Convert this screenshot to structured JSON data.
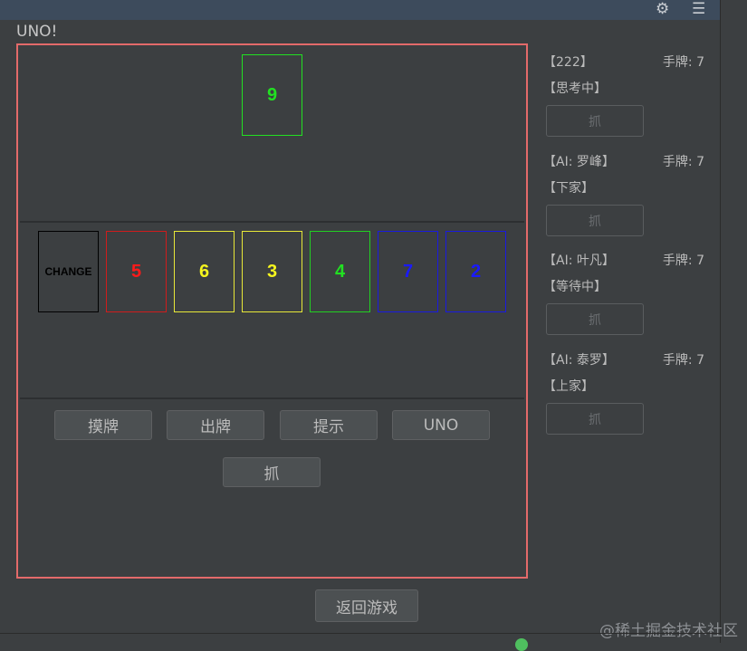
{
  "app": {
    "title": "UNO!"
  },
  "titlebar": {
    "settings_icon": "gear-icon",
    "minimize_icon": "minimize-icon"
  },
  "discard_pile": {
    "label": "9",
    "color": "#22e022"
  },
  "hand": [
    {
      "label": "CHANGE",
      "color": "#000000",
      "border": "#000000"
    },
    {
      "label": "5",
      "color": "#ff1a1a",
      "border": "#d01c1c"
    },
    {
      "label": "6",
      "color": "#f5f51e",
      "border": "#e8e838"
    },
    {
      "label": "3",
      "color": "#f5f51e",
      "border": "#e8e838"
    },
    {
      "label": "4",
      "color": "#22e022",
      "border": "#22d022"
    },
    {
      "label": "7",
      "color": "#1a1aff",
      "border": "#1a1ae0"
    },
    {
      "label": "2",
      "color": "#1a1aff",
      "border": "#1a1ae0"
    }
  ],
  "actions": {
    "draw": "摸牌",
    "play": "出牌",
    "hint": "提示",
    "uno": "UNO",
    "grab": "抓"
  },
  "players": [
    {
      "name": "【222】",
      "count": "手牌: 7",
      "status": "【思考中】",
      "grab": "抓"
    },
    {
      "name": "【AI: 罗峰】",
      "count": "手牌: 7",
      "status": "【下家】",
      "grab": "抓"
    },
    {
      "name": "【AI: 叶凡】",
      "count": "手牌: 7",
      "status": "【等待中】",
      "grab": "抓"
    },
    {
      "name": "【AI: 泰罗】",
      "count": "手牌: 7",
      "status": "【上家】",
      "grab": "抓"
    }
  ],
  "return_button": "返回游戏",
  "watermark": "@稀土掘金技术社区",
  "colors": {
    "board_border": "#e36a6a",
    "background": "#3c3f41"
  }
}
